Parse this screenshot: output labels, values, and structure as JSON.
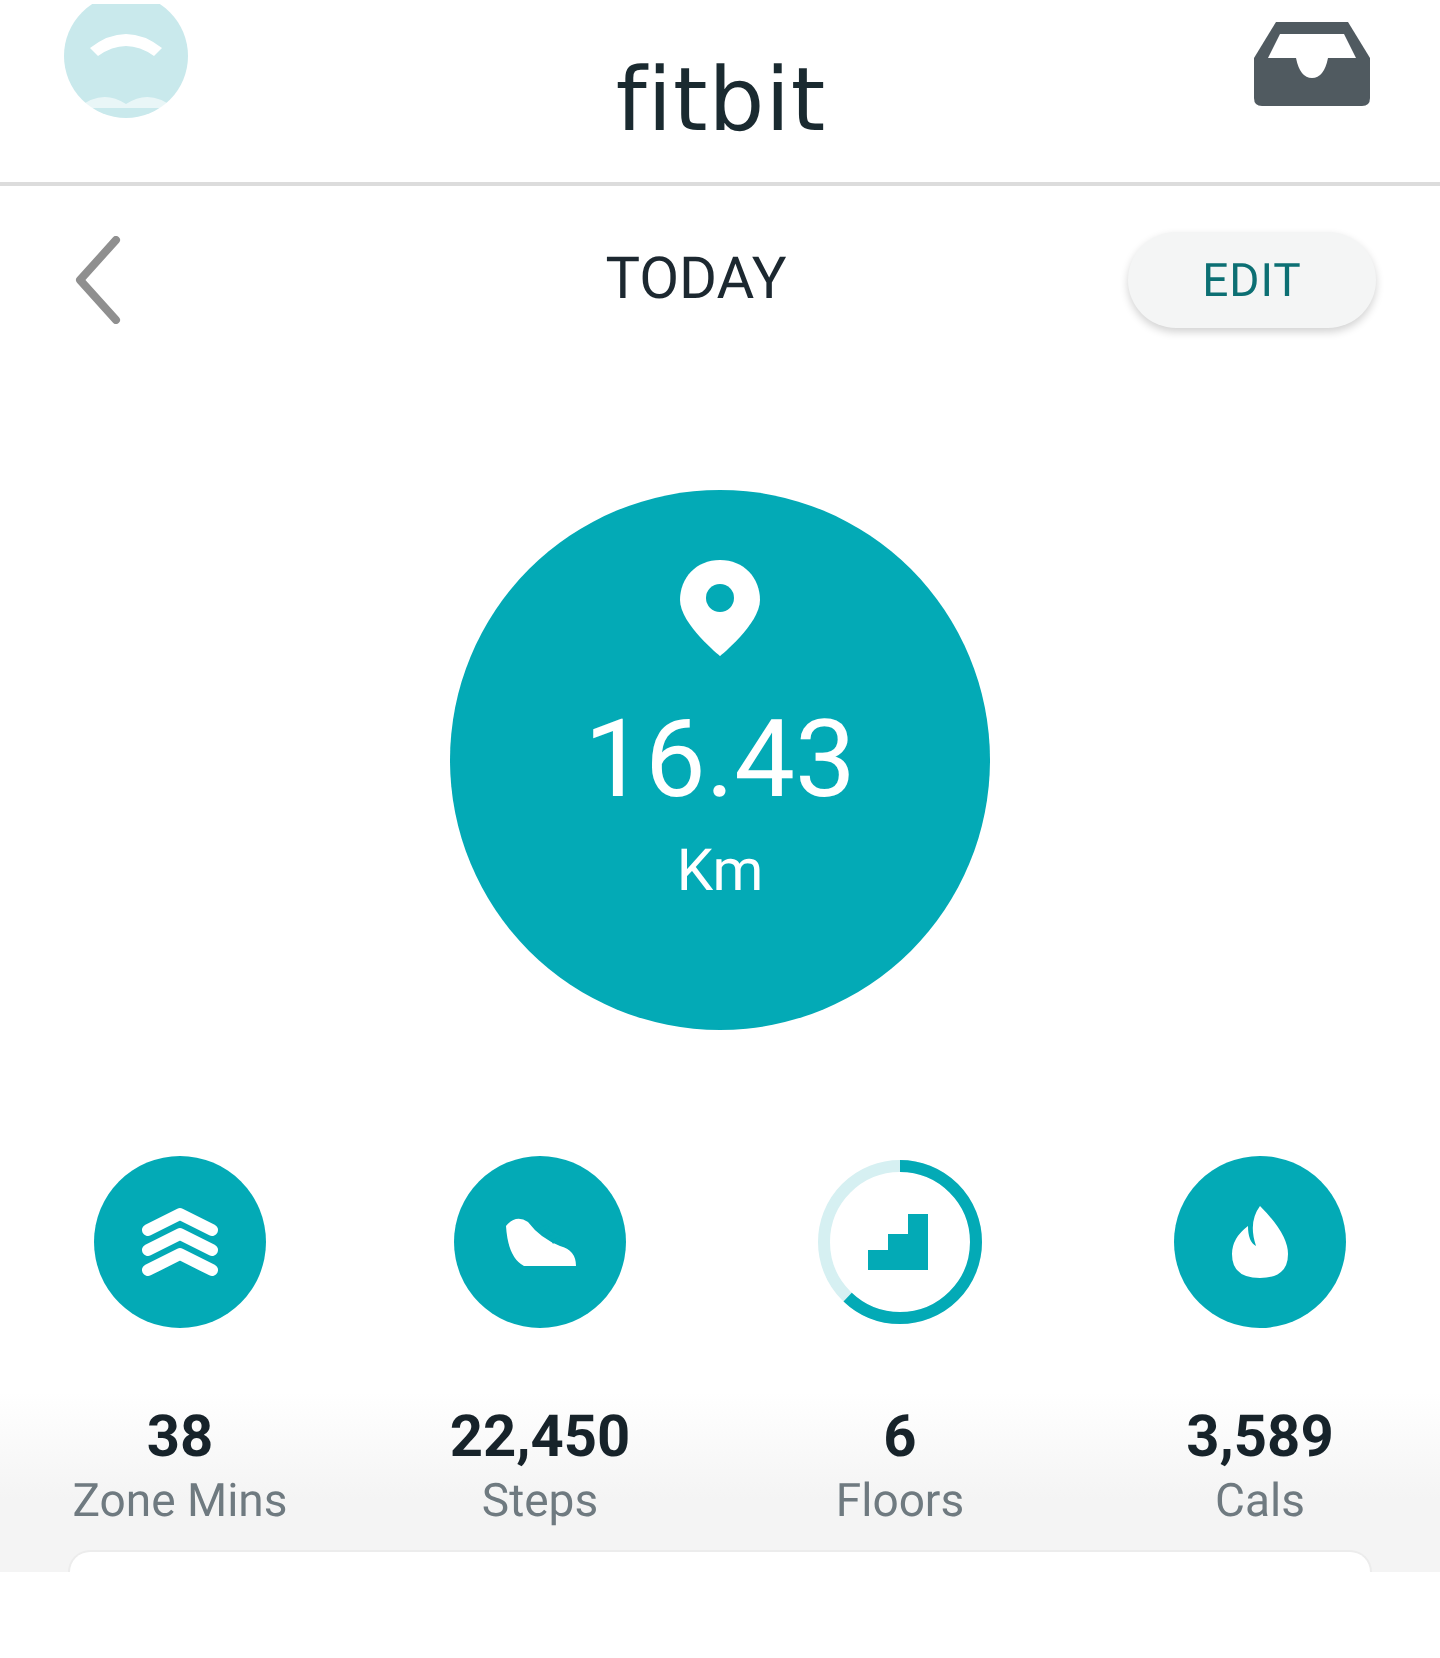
{
  "header": {
    "title": "fitbit"
  },
  "subheader": {
    "title": "TODAY",
    "edit_button": "EDIT"
  },
  "hero": {
    "value": "16.43",
    "unit": "Km"
  },
  "stats": [
    {
      "kind": "badge",
      "value": "38",
      "label": "Zone Mins"
    },
    {
      "kind": "badge",
      "value": "22,450",
      "label": "Steps"
    },
    {
      "kind": "progress",
      "value": "6",
      "label": "Floors",
      "level": 0.62
    },
    {
      "kind": "badge",
      "value": "3,589",
      "label": "Cals"
    }
  ]
}
